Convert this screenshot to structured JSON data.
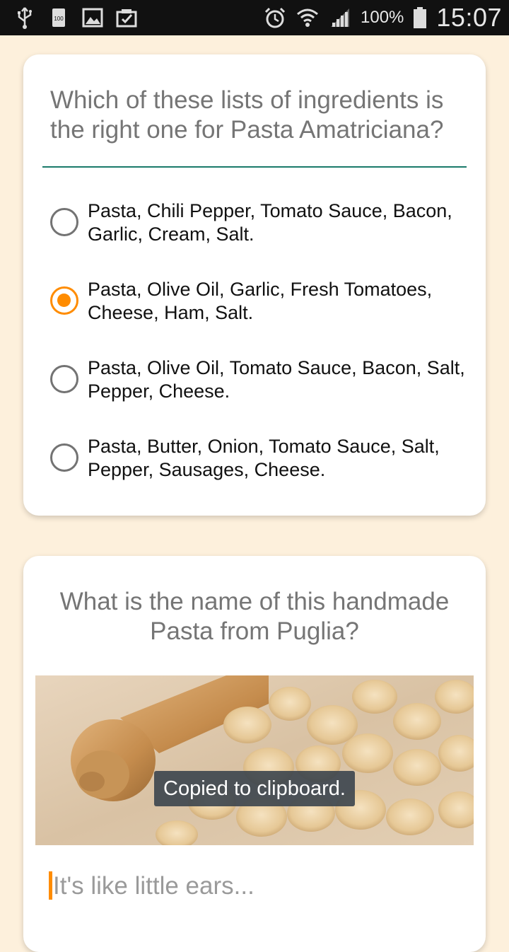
{
  "status_bar": {
    "icons_left": [
      "usb-icon",
      "battery-100-icon",
      "image-icon",
      "clipboard-check-icon"
    ],
    "icons_right": [
      "alarm-icon",
      "wifi-icon",
      "signal-icon",
      "battery-icon"
    ],
    "battery_percent": "100%",
    "time": "15:07"
  },
  "question1": {
    "text": "Which of these lists of ingredients is the right one for Pasta Amatriciana?",
    "options": [
      {
        "label": "Pasta, Chili Pepper, Tomato Sauce, Bacon, Garlic, Cream, Salt.",
        "selected": false
      },
      {
        "label": "Pasta, Olive Oil, Garlic, Fresh Tomatoes, Cheese, Ham, Salt.",
        "selected": true
      },
      {
        "label": "Pasta, Olive Oil, Tomato Sauce, Bacon, Salt, Pepper, Cheese.",
        "selected": false
      },
      {
        "label": "Pasta, Butter, Onion, Tomato Sauce, Salt, Pepper, Sausages, Cheese.",
        "selected": false
      }
    ]
  },
  "question2": {
    "text": "What is the name of this handmade Pasta from Puglia?",
    "answer_placeholder": "It's like little ears..."
  },
  "toast": {
    "text": "Copied to clipboard."
  },
  "colors": {
    "background": "#fdf0dc",
    "accent": "#ff8c00",
    "rule": "#1a7a6a",
    "status_bar": "#111111"
  }
}
